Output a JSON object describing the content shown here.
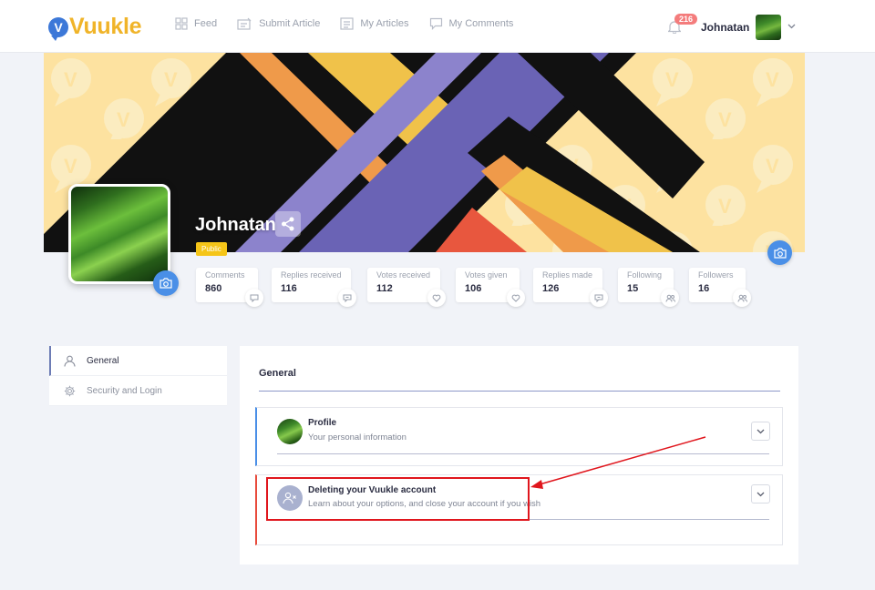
{
  "brand": {
    "name": "Vuukle",
    "badge_letter": "V"
  },
  "nav": [
    {
      "label": "Feed",
      "icon": "grid-icon"
    },
    {
      "label": "Submit Article",
      "icon": "submit-article-icon"
    },
    {
      "label": "My Articles",
      "icon": "articles-icon"
    },
    {
      "label": "My Comments",
      "icon": "comment-icon"
    }
  ],
  "header": {
    "notification_count": "216",
    "user_name": "Johnatan"
  },
  "profile": {
    "display_name": "Johnatan",
    "visibility": "Public"
  },
  "stats": [
    {
      "label": "Comments",
      "value": "860",
      "icon": "comment-icon"
    },
    {
      "label": "Replies received",
      "value": "116",
      "icon": "reply-icon"
    },
    {
      "label": "Votes received",
      "value": "112",
      "icon": "heart-icon"
    },
    {
      "label": "Votes given",
      "value": "106",
      "icon": "heart-icon"
    },
    {
      "label": "Replies made",
      "value": "126",
      "icon": "reply-icon"
    },
    {
      "label": "Following",
      "value": "15",
      "icon": "users-icon"
    },
    {
      "label": "Followers",
      "value": "16",
      "icon": "users-icon"
    }
  ],
  "sidebar": {
    "items": [
      {
        "label": "General",
        "icon": "user-icon",
        "active": true
      },
      {
        "label": "Security and Login",
        "icon": "gear-icon",
        "active": false
      }
    ]
  },
  "main": {
    "title": "General",
    "sections": [
      {
        "title": "Profile",
        "subtitle": "Your personal information"
      },
      {
        "title": "Deleting your Vuukle account",
        "subtitle": "Learn about your options, and close your account if you wish"
      }
    ]
  },
  "colors": {
    "brand_yellow": "#f0b429",
    "brand_blue": "#3c78d8",
    "accent_blue": "#4a8fe7",
    "danger_red": "#e84b3c",
    "annotation_red": "#e0161d",
    "banner_purple": "#6a63b5"
  }
}
